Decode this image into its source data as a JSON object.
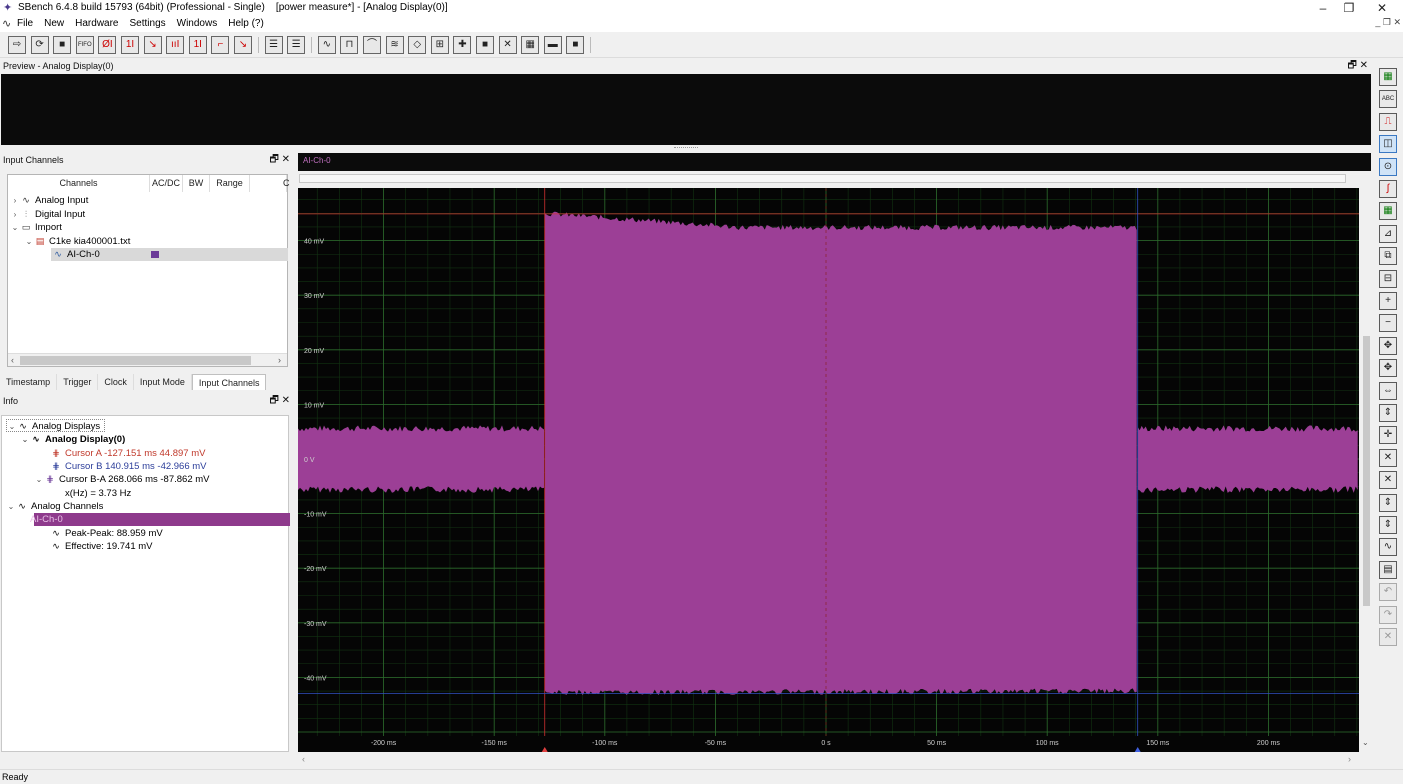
{
  "window": {
    "title": "SBench 6.4.8 build 15793 (64bit) (Professional - Single)    [power measure*] - [Analog Display(0)]",
    "minimize": "–",
    "restore": "❐",
    "close": "✕"
  },
  "menu": {
    "items": [
      "File",
      "New",
      "Hardware",
      "Settings",
      "Windows",
      "Help (?)"
    ],
    "right_controls": "_ ❐ ✕"
  },
  "toolbar": {
    "buttons": [
      "⇨",
      "⟳",
      "■",
      "FIFO",
      "ØI",
      "1I",
      "↘",
      "ııI",
      "1I",
      "⌐",
      "↘"
    ],
    "buttons2": [
      "☰",
      "☰"
    ],
    "buttons3": [
      "∿",
      "⊓",
      "⌒",
      "≋",
      "◇",
      "⊞",
      "✚",
      "■",
      "✕",
      "▦",
      "▬",
      "■"
    ]
  },
  "preview": {
    "title": "Preview - Analog Display(0)",
    "controls": "🗗 ✕"
  },
  "input_channels": {
    "title": "Input Channels",
    "controls": "🗗 ✕",
    "columns": [
      "Channels",
      "AC/DC",
      "BW",
      "Range",
      "C"
    ],
    "tree": [
      {
        "label": "Analog Input",
        "arrow": "›",
        "icon": "∿"
      },
      {
        "label": "Digital Input",
        "arrow": "›",
        "icon": "⫶"
      },
      {
        "label": "Import",
        "arrow": "⌄",
        "icon": "▭"
      },
      {
        "label": "C1ke kia400001.txt",
        "arrow": "⌄",
        "icon": "▤"
      },
      {
        "label": "AI-Ch-0",
        "arrow": "",
        "icon": "∿"
      }
    ],
    "scroll_left": "‹",
    "scroll_right": "›"
  },
  "tabs": [
    "Timestamp",
    "Trigger",
    "Clock",
    "Input Mode",
    "Input Channels"
  ],
  "info": {
    "title": "Info",
    "controls": "🗗 ✕",
    "analog_displays": "Analog Displays",
    "analog_display0": "Analog Display(0)",
    "cursor_a": "Cursor A  -127.151 ms  44.897 mV",
    "cursor_b": "Cursor B  140.915 ms  -42.966 mV",
    "cursor_ba": "Cursor B-A  268.066 ms  -87.862 mV",
    "freq": "x(Hz) = 3.73 Hz",
    "analog_channels": "Analog Channels",
    "channel": "AI-Ch-0",
    "peak_peak": "Peak-Peak:  88.959 mV",
    "effective": "Effective:  19.741 mV"
  },
  "scope": {
    "channel_label": "AI-Ch-0",
    "trace_color": "#9c3f96",
    "y_labels": [
      "40 mV",
      "30 mV",
      "20 mV",
      "10 mV",
      "0 V",
      "-10 mV",
      "-20 mV",
      "-30 mV",
      "-40 mV"
    ],
    "x_labels": [
      "-200 ms",
      "-150 ms",
      "-100 ms",
      "-50 ms",
      "0 s",
      "50 ms",
      "100 ms",
      "150 ms",
      "200 ms"
    ],
    "cursor_a_ms": -127.151,
    "cursor_b_ms": 140.915,
    "cursor_a_mv": 44.897,
    "cursor_b_mv": -42.966,
    "burst_start_ms": -127.151,
    "burst_end_ms": 140.915,
    "burst_peak_mv": 44.5,
    "baseline_noise_mv": 5.5
  },
  "right_toolbar": [
    "▦",
    "ABC",
    "⎍",
    "◫",
    "⊙",
    "∫",
    "▦",
    "⊿",
    "⧉",
    "⊟",
    "+",
    "−",
    "✥",
    "✥",
    "⇔",
    "⇕",
    "✛",
    "✕",
    "✕",
    "⇕",
    "⇕",
    "∿",
    "▤",
    "↶",
    "↷",
    "✕"
  ],
  "status": {
    "text": "Ready"
  }
}
